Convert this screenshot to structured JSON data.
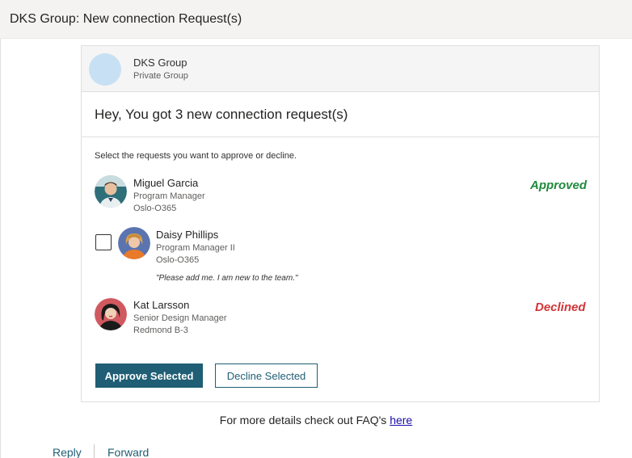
{
  "window": {
    "title": "DKS Group: New connection Request(s)"
  },
  "group": {
    "name": "DKS Group",
    "privacy": "Private Group",
    "avatar_color": "#c7e0f4"
  },
  "headline": "Hey, You got 3 new connection request(s)",
  "instructions": "Select the requests you want to approve or decline.",
  "requests": [
    {
      "name": "Miguel Garcia",
      "role": "Program Manager",
      "location": "Oslo-O365",
      "status": "Approved",
      "avatar_bg": "#2f6f7a"
    },
    {
      "name": "Daisy Phillips",
      "role": "Program Manager II",
      "location": "Oslo-O365",
      "note": "\"Please add me. I am new to the team.\"",
      "checked": false,
      "avatar_bg": "#5a74b0"
    },
    {
      "name": "Kat Larsson",
      "role": "Senior Design Manager",
      "location": "Redmond B-3",
      "status": "Declined",
      "avatar_bg": "#c4262e"
    }
  ],
  "buttons": {
    "approve": "Approve Selected",
    "decline": "Decline Selected"
  },
  "footer": {
    "faq_text": "For more details check out FAQ's ",
    "faq_link": "here"
  },
  "actions": {
    "reply": "Reply",
    "forward": "Forward"
  },
  "colors": {
    "primary": "#1f5e74",
    "approved": "#1e8a3b",
    "declined": "#d13438"
  }
}
